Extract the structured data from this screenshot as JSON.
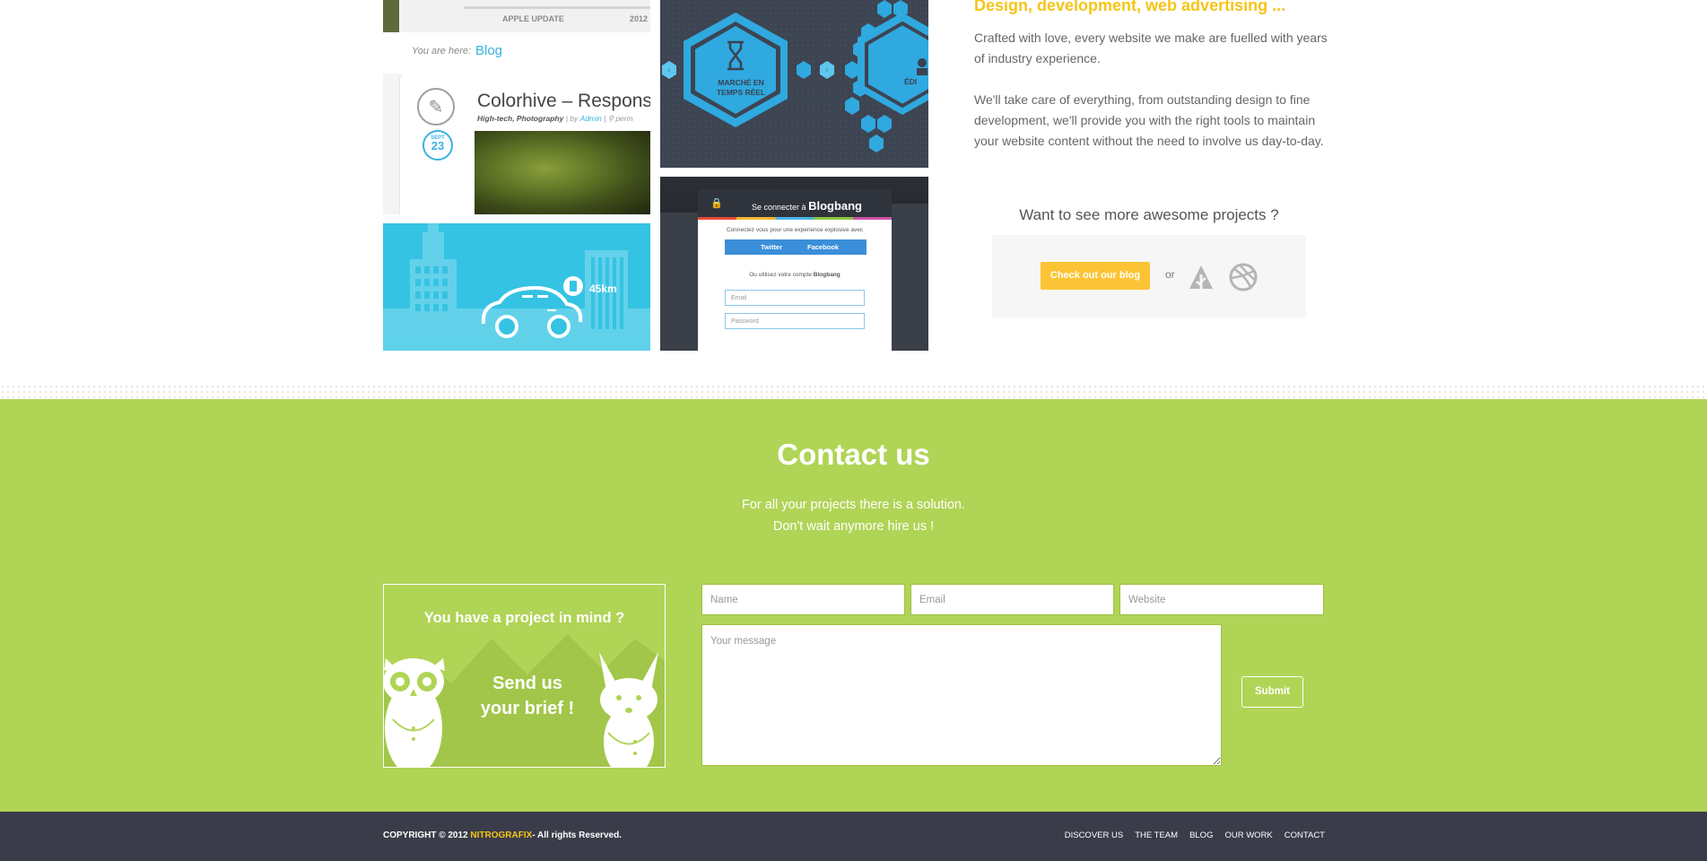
{
  "portfolio": {
    "blog_thumb": {
      "topbar_label": "APPLE UPDATE",
      "topbar_year": "2012",
      "breadcrumb_prefix": "You are here:",
      "breadcrumb_link": "Blog",
      "post_title": "Colorhive – Responsiv",
      "post_categories": "High-tech, Photography",
      "post_by": "by",
      "post_author": "Admin",
      "post_perm": "perm",
      "date_month": "SEPT",
      "date_day": "23"
    },
    "hex_thumb": {
      "label_line1": "MARCHÉ EN",
      "label_line2": "TEMPS RÉEL",
      "label_right": "ÉDI"
    },
    "city_thumb": {
      "distance": "45km"
    },
    "login_thumb": {
      "title_prefix": "Se connecter à",
      "title_brand": "Blogbang",
      "subtitle": "Connectez vous pour une experience explosive avec",
      "twitter": "Twitter",
      "facebook": "Facebook",
      "or_label": "Ou utilisez votre compte",
      "or_brand": "Blogbang",
      "email_placeholder": "Email",
      "password_placeholder": "Password"
    }
  },
  "about": {
    "heading": "Design, development, web advertising ...",
    "para1": "Crafted with love, every website we make are fuelled with years of industry experience.",
    "para2": "We'll take care of everything, from outstanding design to fine development, we'll provide you with the right tools to maintain your website content without the need to involve us day-to-day.",
    "more_title": "Want to see more awesome projects ?",
    "blog_button": "Check out our blog",
    "or": "or",
    "social_icons": [
      "forrst-icon",
      "dribbble-icon"
    ]
  },
  "contact": {
    "title": "Contact us",
    "sub1": "For all your projects there is a solution.",
    "sub2": "Don't wait anymore hire us !",
    "brief_question": "You have a project in mind ?",
    "brief_line1": "Send us",
    "brief_line2": "your brief !",
    "name_placeholder": "Name",
    "email_placeholder": "Email",
    "website_placeholder": "Website",
    "message_placeholder": "Your message",
    "submit_label": "Submit"
  },
  "footer": {
    "copyright_prefix": "COPYRIGHT © 2012",
    "brand": "NITROGRAFIX",
    "copyright_suffix": "- All rights Reserved.",
    "nav": [
      "DISCOVER US",
      "THE TEAM",
      "BLOG",
      "OUR WORK",
      "CONTACT"
    ]
  },
  "colors": {
    "accent_yellow": "#f5c518",
    "contact_green": "#b0d456",
    "footer_dark": "#3b3c4a",
    "link_blue": "#39b3e0"
  }
}
